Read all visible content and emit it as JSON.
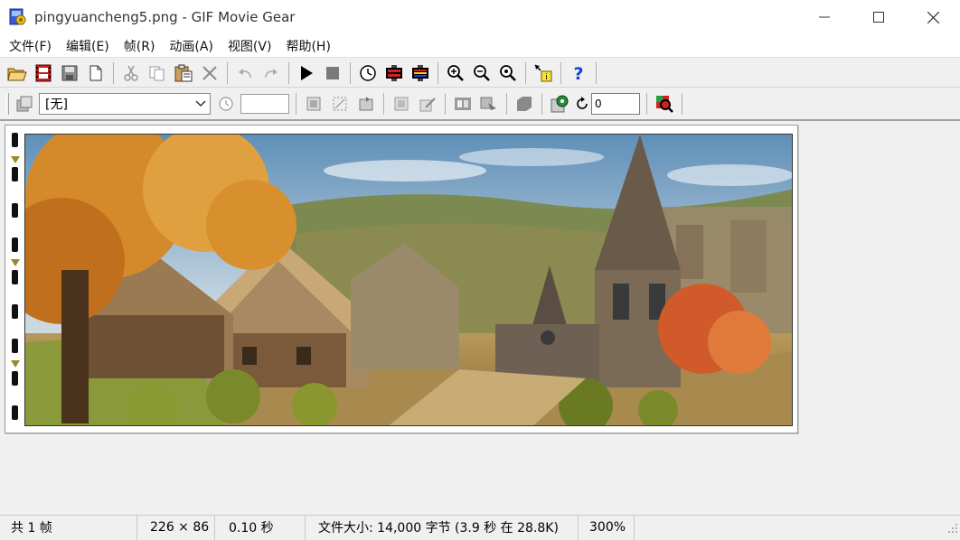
{
  "window": {
    "title": "pingyuancheng5.png - GIF Movie Gear",
    "minimize_icon": "minimize-icon",
    "maximize_icon": "maximize-icon",
    "close_icon": "close-icon"
  },
  "menu": {
    "items": [
      {
        "label": "文件(F)"
      },
      {
        "label": "编辑(E)"
      },
      {
        "label": "帧(R)"
      },
      {
        "label": "动画(A)"
      },
      {
        "label": "视图(V)"
      },
      {
        "label": "帮助(H)"
      }
    ]
  },
  "toolbar2": {
    "transparency_select": "[无]",
    "loop_count": "0"
  },
  "image": {
    "description_icon": "scene-image"
  },
  "status": {
    "frames": "共 1 帧",
    "dimensions": "226 × 86",
    "delay": "0.10 秒",
    "filesize": "文件大小: 14,000 字节  (3.9 秒 在 28.8K)",
    "zoom": "300%"
  },
  "colors": {
    "title_bg": "#ffffff",
    "app_bg": "#f0f0f0",
    "help_blue": "#1a3fd0",
    "filmstrip_marker": "#9b8a2a"
  }
}
